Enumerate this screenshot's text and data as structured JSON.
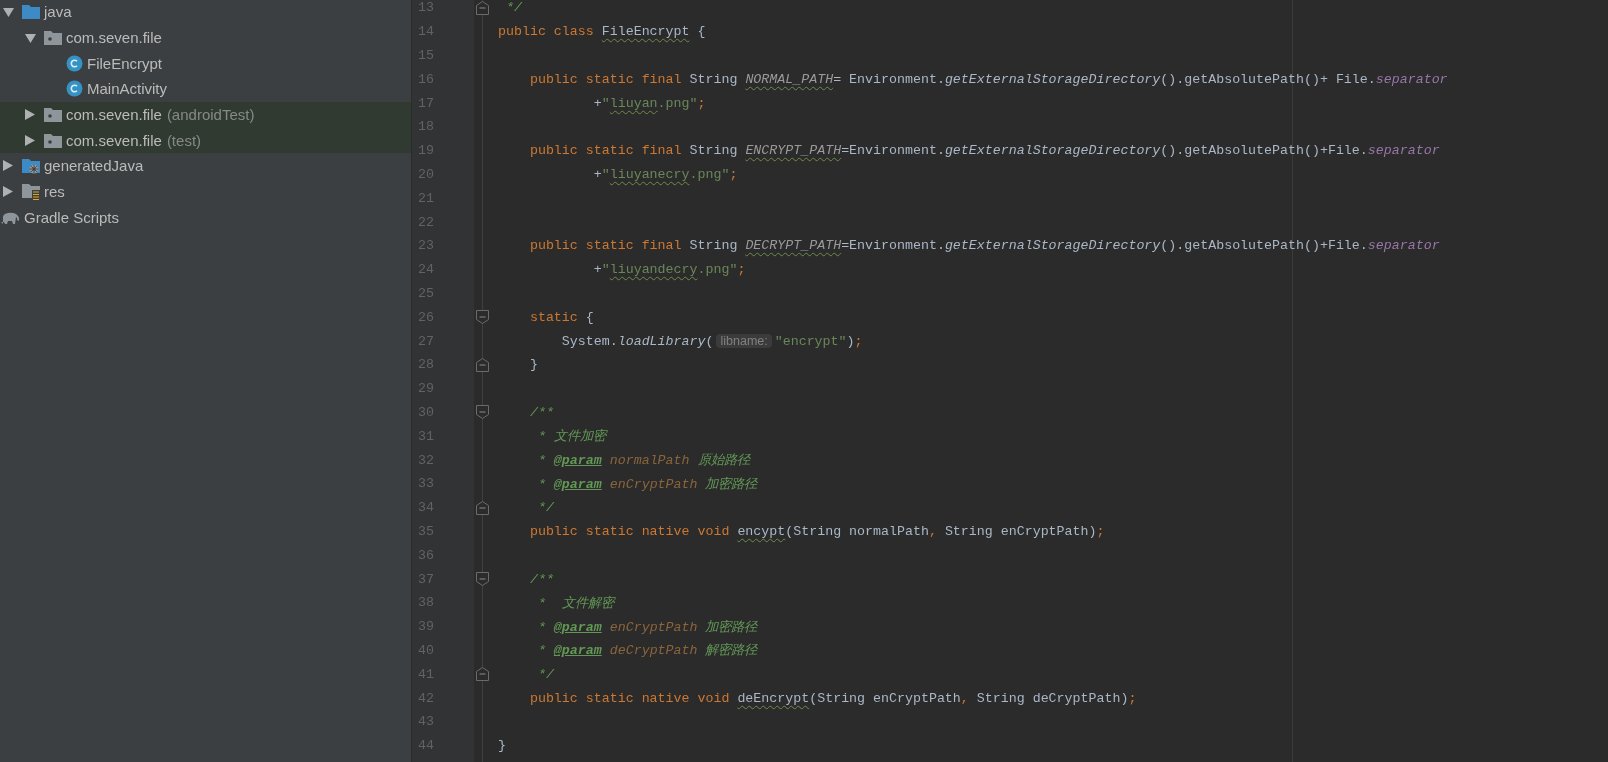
{
  "project_tree": [
    {
      "label": "java",
      "kind": "source-folder",
      "expanded": true,
      "highlighted": false,
      "children": [
        {
          "label": "com.seven.file",
          "kind": "package",
          "expanded": true,
          "highlighted": false,
          "children": [
            {
              "label": "FileEncrypt",
              "kind": "class",
              "highlighted": false
            },
            {
              "label": "MainActivity",
              "kind": "class",
              "highlighted": false
            }
          ]
        },
        {
          "label": "com.seven.file",
          "suffix": "(androidTest)",
          "kind": "package",
          "expanded": false,
          "highlighted": true
        },
        {
          "label": "com.seven.file",
          "suffix": "(test)",
          "kind": "package",
          "expanded": false,
          "highlighted": true
        }
      ]
    },
    {
      "label": "generatedJava",
      "kind": "generated-folder",
      "expanded": false,
      "highlighted": false
    },
    {
      "label": "res",
      "kind": "resource-folder",
      "expanded": false,
      "highlighted": false
    },
    {
      "label": "Gradle Scripts",
      "kind": "gradle",
      "highlighted": false
    }
  ],
  "editor": {
    "lines": [
      {
        "number": "13",
        "kind": "fold-end",
        "tokens": [
          {
            "kind": "cm",
            "s": " */"
          }
        ]
      },
      {
        "number": "14",
        "kind": "code",
        "tokens": [
          {
            "kind": "kw",
            "s": "public class "
          },
          {
            "kind": "pl",
            "s": "FileEncrypt",
            "typo": true
          },
          {
            "kind": "pl",
            "s": " {"
          }
        ]
      },
      {
        "number": "15",
        "kind": "code"
      },
      {
        "number": "16",
        "kind": "code",
        "tokens": [
          {
            "kind": "kw",
            "s": "    public static final "
          },
          {
            "kind": "pl",
            "s": "String "
          },
          {
            "kind": "cst",
            "s": "NORMAL_PATH",
            "typo": true
          },
          {
            "kind": "pl",
            "s": "= Environment."
          },
          {
            "kind": "it",
            "s": "getExternalStorageDirectory"
          },
          {
            "kind": "pl",
            "s": "().getAbsolutePath()+ File."
          },
          {
            "kind": "fld",
            "s": "separator"
          }
        ]
      },
      {
        "number": "17",
        "kind": "code",
        "tokens": [
          {
            "kind": "pl",
            "s": "            +"
          },
          {
            "kind": "str",
            "s": "\""
          },
          {
            "kind": "str",
            "s": "liuyan",
            "typo": true
          },
          {
            "kind": "str",
            "s": ".png\""
          },
          {
            "kind": "kw",
            "s": ";"
          }
        ]
      },
      {
        "number": "18",
        "kind": "code"
      },
      {
        "number": "19",
        "kind": "code",
        "tokens": [
          {
            "kind": "kw",
            "s": "    public static final "
          },
          {
            "kind": "pl",
            "s": "String "
          },
          {
            "kind": "cst",
            "s": "ENCRYPT_PATH",
            "typo": true
          },
          {
            "kind": "pl",
            "s": "=Environment."
          },
          {
            "kind": "it",
            "s": "getExternalStorageDirectory"
          },
          {
            "kind": "pl",
            "s": "().getAbsolutePath()+File."
          },
          {
            "kind": "fld",
            "s": "separator"
          }
        ]
      },
      {
        "number": "20",
        "kind": "code",
        "tokens": [
          {
            "kind": "pl",
            "s": "            +"
          },
          {
            "kind": "str",
            "s": "\""
          },
          {
            "kind": "str",
            "s": "liuyanecry",
            "typo": true
          },
          {
            "kind": "str",
            "s": ".png\""
          },
          {
            "kind": "kw",
            "s": ";"
          }
        ]
      },
      {
        "number": "21",
        "kind": "code"
      },
      {
        "number": "22",
        "kind": "code"
      },
      {
        "number": "23",
        "kind": "code",
        "tokens": [
          {
            "kind": "kw",
            "s": "    public static final "
          },
          {
            "kind": "pl",
            "s": "String "
          },
          {
            "kind": "cst",
            "s": "DECRYPT_PATH",
            "typo": true
          },
          {
            "kind": "pl",
            "s": "=Environment."
          },
          {
            "kind": "it",
            "s": "getExternalStorageDirectory"
          },
          {
            "kind": "pl",
            "s": "().getAbsolutePath()+File."
          },
          {
            "kind": "fld",
            "s": "separator"
          }
        ]
      },
      {
        "number": "24",
        "kind": "code",
        "tokens": [
          {
            "kind": "pl",
            "s": "            +"
          },
          {
            "kind": "str",
            "s": "\""
          },
          {
            "kind": "str",
            "s": "liuyandecry",
            "typo": true
          },
          {
            "kind": "str",
            "s": ".png\""
          },
          {
            "kind": "kw",
            "s": ";"
          }
        ]
      },
      {
        "number": "25",
        "kind": "code"
      },
      {
        "number": "26",
        "kind": "fold-start",
        "tokens": [
          {
            "kind": "kw",
            "s": "    static"
          },
          {
            "kind": "pl",
            "s": " {"
          }
        ]
      },
      {
        "number": "27",
        "kind": "code",
        "tokens": [
          {
            "kind": "pl",
            "s": "        System."
          },
          {
            "kind": "it",
            "s": "loadLibrary"
          },
          {
            "kind": "pl",
            "s": "("
          },
          {
            "kind": "hint",
            "s": "libname:"
          },
          {
            "kind": "str",
            "s": "\"encrypt\""
          },
          {
            "kind": "pl",
            "s": ")"
          },
          {
            "kind": "kw",
            "s": ";"
          }
        ]
      },
      {
        "number": "28",
        "kind": "fold-end",
        "tokens": [
          {
            "kind": "pl",
            "s": "    }"
          }
        ]
      },
      {
        "number": "29",
        "kind": "code"
      },
      {
        "number": "30",
        "kind": "fold-start",
        "tokens": [
          {
            "kind": "cm",
            "s": "    /**"
          }
        ]
      },
      {
        "number": "31",
        "kind": "code",
        "tokens": [
          {
            "kind": "cm",
            "s": "     * 文件加密"
          }
        ]
      },
      {
        "number": "32",
        "kind": "code",
        "tokens": [
          {
            "kind": "cm",
            "s": "     * "
          },
          {
            "kind": "tag",
            "s": "@param"
          },
          {
            "kind": "prm",
            "s": " normalPath"
          },
          {
            "kind": "cm",
            "s": " 原始路径"
          }
        ]
      },
      {
        "number": "33",
        "kind": "code",
        "tokens": [
          {
            "kind": "cm",
            "s": "     * "
          },
          {
            "kind": "tag",
            "s": "@param"
          },
          {
            "kind": "prm",
            "s": " enCryptPath"
          },
          {
            "kind": "cm",
            "s": " 加密路径"
          }
        ]
      },
      {
        "number": "34",
        "kind": "fold-end",
        "tokens": [
          {
            "kind": "cm",
            "s": "     */"
          }
        ]
      },
      {
        "number": "35",
        "kind": "code",
        "tokens": [
          {
            "kind": "kw",
            "s": "    public static native void "
          },
          {
            "kind": "pl",
            "s": "encypt",
            "typo": true
          },
          {
            "kind": "pl",
            "s": "(String normalPath"
          },
          {
            "kind": "kw",
            "s": ", "
          },
          {
            "kind": "pl",
            "s": "String enCryptPath)"
          },
          {
            "kind": "kw",
            "s": ";"
          }
        ]
      },
      {
        "number": "36",
        "kind": "code"
      },
      {
        "number": "37",
        "kind": "fold-start",
        "tokens": [
          {
            "kind": "cm",
            "s": "    /**"
          }
        ]
      },
      {
        "number": "38",
        "kind": "code",
        "tokens": [
          {
            "kind": "cm",
            "s": "     *  文件解密"
          }
        ]
      },
      {
        "number": "39",
        "kind": "code",
        "tokens": [
          {
            "kind": "cm",
            "s": "     * "
          },
          {
            "kind": "tag",
            "s": "@param"
          },
          {
            "kind": "prm",
            "s": " enCryptPath"
          },
          {
            "kind": "cm",
            "s": " 加密路径"
          }
        ]
      },
      {
        "number": "40",
        "kind": "code",
        "tokens": [
          {
            "kind": "cm",
            "s": "     * "
          },
          {
            "kind": "tag",
            "s": "@param"
          },
          {
            "kind": "prm",
            "s": " deCryptPath"
          },
          {
            "kind": "cm",
            "s": " 解密路径"
          }
        ]
      },
      {
        "number": "41",
        "kind": "fold-end",
        "tokens": [
          {
            "kind": "cm",
            "s": "     */"
          }
        ]
      },
      {
        "number": "42",
        "kind": "code",
        "tokens": [
          {
            "kind": "kw",
            "s": "    public static native void "
          },
          {
            "kind": "pl",
            "s": "deEncrypt",
            "typo": true
          },
          {
            "kind": "pl",
            "s": "(String enCryptPath"
          },
          {
            "kind": "kw",
            "s": ", "
          },
          {
            "kind": "pl",
            "s": "String deCryptPath)"
          },
          {
            "kind": "kw",
            "s": ";"
          }
        ]
      },
      {
        "number": "43",
        "kind": "code"
      },
      {
        "number": "44",
        "kind": "code",
        "tokens": [
          {
            "kind": "pl",
            "s": "}"
          }
        ]
      }
    ]
  }
}
